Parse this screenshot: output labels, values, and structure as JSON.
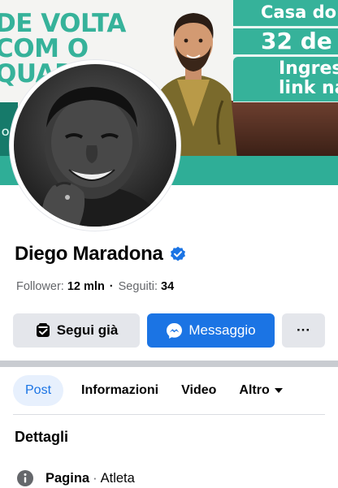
{
  "cover": {
    "left_lines": [
      "DE VOLTA",
      "COM O",
      "QUADR"
    ],
    "side_label": "O",
    "banner_line1": "Casa do",
    "banner_line2": "32 de",
    "banner_line3a": "Ingres",
    "banner_line3b": "link na"
  },
  "profile": {
    "name": "Diego Maradona",
    "followers_label": "Follower:",
    "followers_value": "12 mln",
    "following_label": "Seguiti:",
    "following_value": "34",
    "separator": "·"
  },
  "actions": {
    "follow_label": "Segui già",
    "message_label": "Messaggio",
    "more_label": "···"
  },
  "tabs": {
    "post": "Post",
    "info": "Informazioni",
    "video": "Video",
    "more": "Altro"
  },
  "details": {
    "heading": "Dettagli",
    "page_label": "Pagina",
    "page_sep": "·",
    "page_value": "Atleta"
  },
  "colors": {
    "accent_blue": "#1b74e4",
    "cover_teal": "#36b29a",
    "verified_blue": "#1b74e4"
  },
  "icons": [
    "verified-badge-icon",
    "following-check-icon",
    "messenger-icon",
    "more-dots-icon",
    "caret-down-icon",
    "info-icon"
  ]
}
